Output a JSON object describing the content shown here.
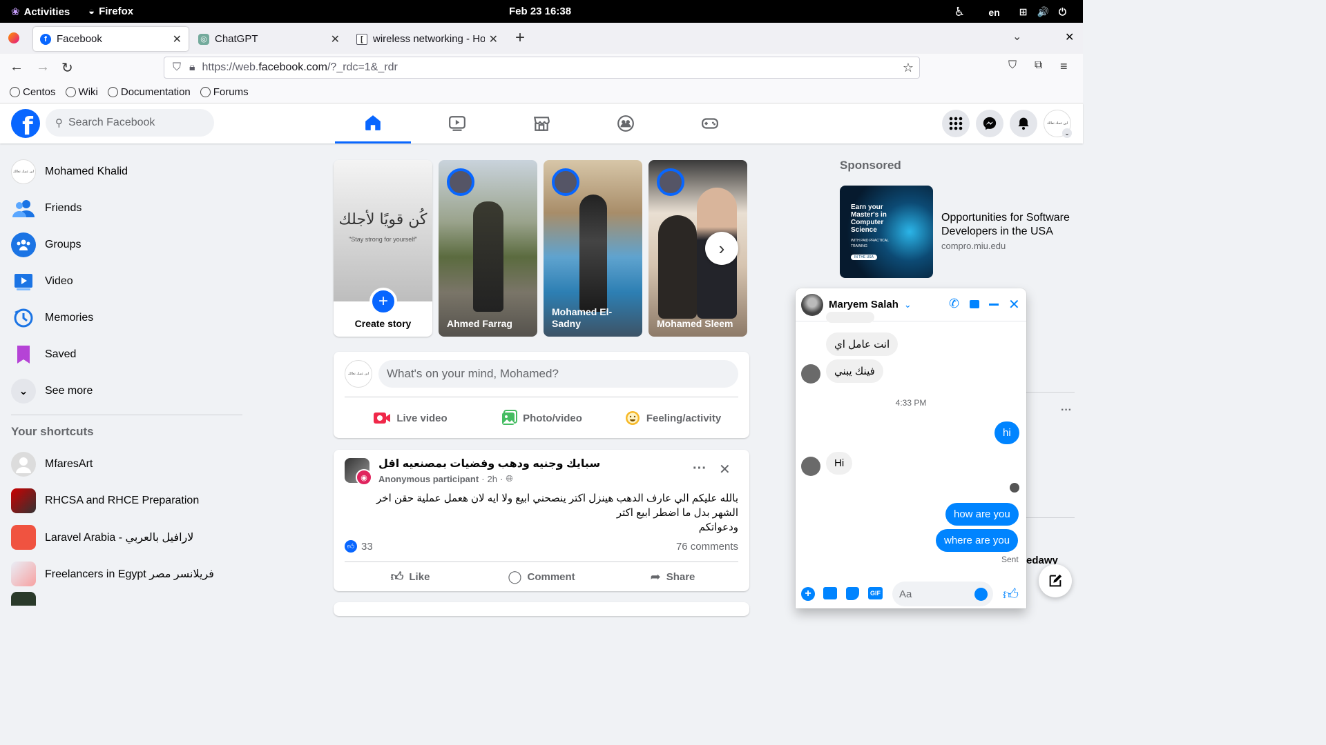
{
  "system": {
    "activities": "Activities",
    "app": "Firefox",
    "clock": "Feb 23  16:38",
    "lang": "en"
  },
  "browser": {
    "tabs": [
      {
        "title": "Facebook"
      },
      {
        "title": "ChatGPT"
      },
      {
        "title": "wireless networking - How"
      }
    ],
    "url_prefix": "https://web.",
    "url_domain": "facebook.com",
    "url_suffix": "/?_rdc=1&_rdr",
    "bookmarks": [
      "Centos",
      "Wiki",
      "Documentation",
      "Forums"
    ]
  },
  "fb": {
    "logo": "f",
    "search_placeholder": "Search Facebook",
    "profile_badge": "ابن عمك تعالك",
    "sidebar": [
      {
        "label": "Mohamed Khalid",
        "icon": "profile-avatar"
      },
      {
        "label": "Friends",
        "icon": "friends-icon"
      },
      {
        "label": "Groups",
        "icon": "groups-icon"
      },
      {
        "label": "Video",
        "icon": "video-icon"
      },
      {
        "label": "Memories",
        "icon": "memories-icon"
      },
      {
        "label": "Saved",
        "icon": "saved-icon"
      },
      {
        "label": "See more",
        "icon": "chevron-down-icon"
      }
    ],
    "shortcuts_title": "Your shortcuts",
    "shortcuts": [
      {
        "label": "MfaresArt"
      },
      {
        "label": "RHCSA and RHCE Preparation"
      },
      {
        "label": "Laravel Arabia - لارافيل بالعربي"
      },
      {
        "label": "Freelancers in Egypt فريلانسر مصر"
      }
    ],
    "stories": {
      "create_label": "Create story",
      "create_quote_ar": "كُن قويًا لأجلك",
      "create_quote_en": "\"Stay strong for yourself\"",
      "items": [
        {
          "name": "Ahmed Farrag"
        },
        {
          "name": "Mohamed El-Sadny"
        },
        {
          "name": "Mohamed Sleem"
        }
      ]
    },
    "composer": {
      "placeholder": "What's on your mind, Mohamed?",
      "live": "Live video",
      "photo": "Photo/video",
      "feeling": "Feeling/activity"
    },
    "post": {
      "group": "سبايك وجنيه ودهب وفضيات بمصنعيه اقل",
      "author": "Anonymous participant",
      "time": "2h",
      "text_line1": "بالله عليكم الي عارف الدهب هينزل اكتر ينصحني ابيع ولا ايه لان هعمل عملية حقن اخر",
      "text_line2": "الشهر بدل ما اضطر ابيع اكتر",
      "text_line3": "ودعواتكم",
      "likes": "33",
      "comments": "76 comments",
      "like": "Like",
      "comment": "Comment",
      "share": "Share"
    },
    "ad": {
      "heading": "Sponsored",
      "title": "Opportunities for Software Developers in the USA",
      "domain": "compro.miu.edu",
      "img_line1": "Earn your Master's in Computer Science",
      "img_line2": "WITH PAID PRACTICAL TRAINING",
      "img_line3": "IN THE USA"
    },
    "contact_partial": "edawy",
    "chat": {
      "name": "Maryem Salah",
      "messages": [
        {
          "text": "انت عامل اي",
          "dir": "in"
        },
        {
          "text": "فينك يبني",
          "dir": "in"
        },
        {
          "text": "4:33 PM",
          "dir": "time"
        },
        {
          "text": "hi",
          "dir": "out"
        },
        {
          "text": "Hi",
          "dir": "in"
        },
        {
          "text": "how are you",
          "dir": "out"
        },
        {
          "text": "where are you",
          "dir": "out"
        }
      ],
      "sent_label": "Sent",
      "input_placeholder": "Aa"
    }
  },
  "colors": {
    "fb_blue": "#0866ff",
    "messenger_blue": "#0084ff",
    "bg": "#f0f2f5"
  }
}
